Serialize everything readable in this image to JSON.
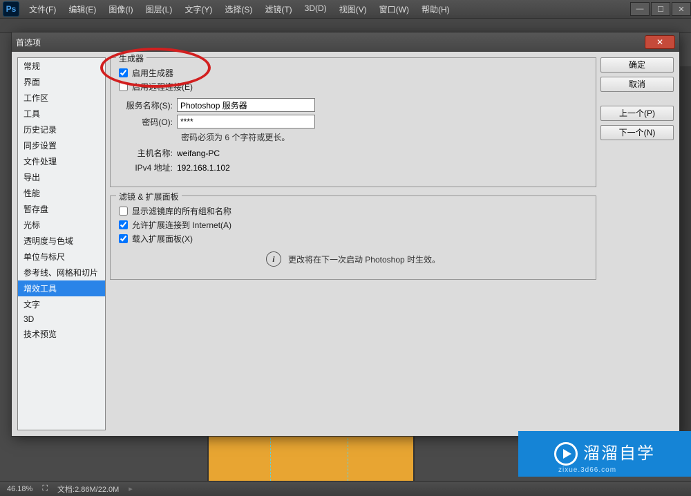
{
  "app": {
    "logo_text": "Ps",
    "menus": [
      "文件(F)",
      "编辑(E)",
      "图像(I)",
      "图层(L)",
      "文字(Y)",
      "选择(S)",
      "滤镜(T)",
      "3D(D)",
      "视图(V)",
      "窗口(W)",
      "帮助(H)"
    ]
  },
  "status": {
    "zoom": "46.18%",
    "doc": "文档:2.86M/22.0M"
  },
  "watermark": {
    "brand": "溜溜自学",
    "url": "zixue.3d66.com"
  },
  "dialog": {
    "title": "首选项",
    "close_x": "✕",
    "sidebar": {
      "items": [
        "常规",
        "界面",
        "工作区",
        "工具",
        "历史记录",
        "同步设置",
        "文件处理",
        "导出",
        "性能",
        "暂存盘",
        "光标",
        "透明度与色域",
        "单位与标尺",
        "参考线、网格和切片",
        "增效工具",
        "文字",
        "3D",
        "技术预览"
      ],
      "selected_index": 14
    },
    "buttons": {
      "ok": "确定",
      "cancel": "取消",
      "prev": "上一个(P)",
      "next": "下一个(N)"
    },
    "generator": {
      "legend": "生成器",
      "enable_generator": "启用生成器",
      "enable_remote": "启用远程连接(E)",
      "service_label": "服务名称(S):",
      "service_value": "Photoshop 服务器",
      "password_label": "密码(O):",
      "password_value": "****",
      "password_hint": "密码必须为 6 个字符或更长。",
      "hostname_label": "主机名称:",
      "hostname_value": "weifang-PC",
      "ipv4_label": "IPv4 地址:",
      "ipv4_value": "192.168.1.102"
    },
    "filter_panel": {
      "legend": "滤镜 & 扩展面板",
      "show_all_groups": "显示滤镜库的所有组和名称",
      "allow_internet": "允许扩展连接到 Internet(A)",
      "load_panels": "载入扩展面板(X)"
    },
    "info_note": "更改将在下一次启动 Photoshop 时生效。"
  }
}
